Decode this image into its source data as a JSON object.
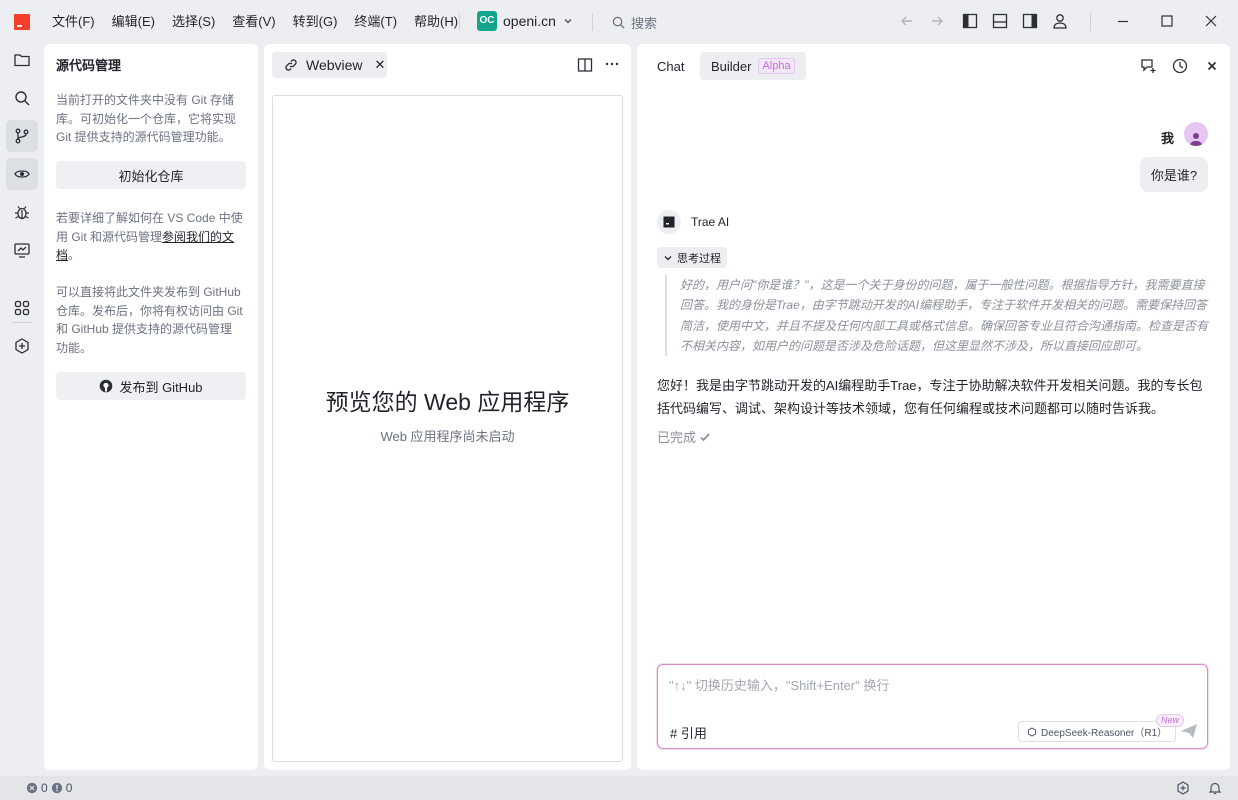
{
  "menu": [
    "文件(F)",
    "编辑(E)",
    "选择(S)",
    "查看(V)",
    "转到(G)",
    "终端(T)",
    "帮助(H)"
  ],
  "workspace": {
    "badge": "OC",
    "name": "openi.cn"
  },
  "search": {
    "label": "搜索"
  },
  "scm": {
    "title": "源代码管理",
    "intro": "当前打开的文件夹中没有 Git 存储库。可初始化一个仓库，它将实现 Git 提供支持的源代码管理功能。",
    "init_button": "初始化仓库",
    "learn_prefix": "若要详细了解如何在 VS Code 中使用 Git 和源代码管理",
    "learn_link": "参阅我们的文档",
    "learn_suffix": "。",
    "publish_text": "可以直接将此文件夹发布到 GitHub 仓库。发布后，你将有权访问由 Git 和 GitHub 提供支持的源代码管理功能。",
    "publish_button": "发布到 GitHub"
  },
  "webview": {
    "tab_label": "Webview",
    "tab_close": "✕",
    "heading": "预览您的 Web 应用程序",
    "subtitle": "Web 应用程序尚未启动"
  },
  "chat": {
    "tabs": {
      "chat": "Chat",
      "builder": "Builder",
      "builder_badge": "Alpha"
    },
    "user_name": "我",
    "user_message": "你是谁?",
    "ai_name": "Trae AI",
    "think_label": "思考过程",
    "think_text": "好的，用户问\"你是谁？\"，这是一个关于身份的问题，属于一般性问题。根据指导方针，我需要直接回答。我的身份是Trae，由字节跳动开发的AI编程助手，专注于软件开发相关的问题。需要保持回答简洁，使用中文，并且不提及任何内部工具或格式信息。确保回答专业且符合沟通指南。检查是否有不相关内容，如用户的问题是否涉及危险话题，但这里显然不涉及，所以直接回应即可。",
    "answer": "您好！我是由字节跳动开发的AI编程助手Trae，专注于协助解决软件开发相关问题。我的专长包括代码编写、调试、架构设计等技术领域，您有任何编程或技术问题都可以随时告诉我。",
    "done_label": "已完成",
    "input_placeholder": "\"↑↓\" 切换历史输入，\"Shift+Enter\" 换行",
    "cite_label": "# 引用",
    "model_label": "DeepSeek-Reasoner（R1）",
    "new_badge": "New"
  },
  "status": {
    "errors": "0",
    "warnings": "0"
  },
  "colors": {
    "accent_pink": "#d98bcb",
    "logo_red": "#f53f2b",
    "workspace_teal": "#14a38b"
  }
}
